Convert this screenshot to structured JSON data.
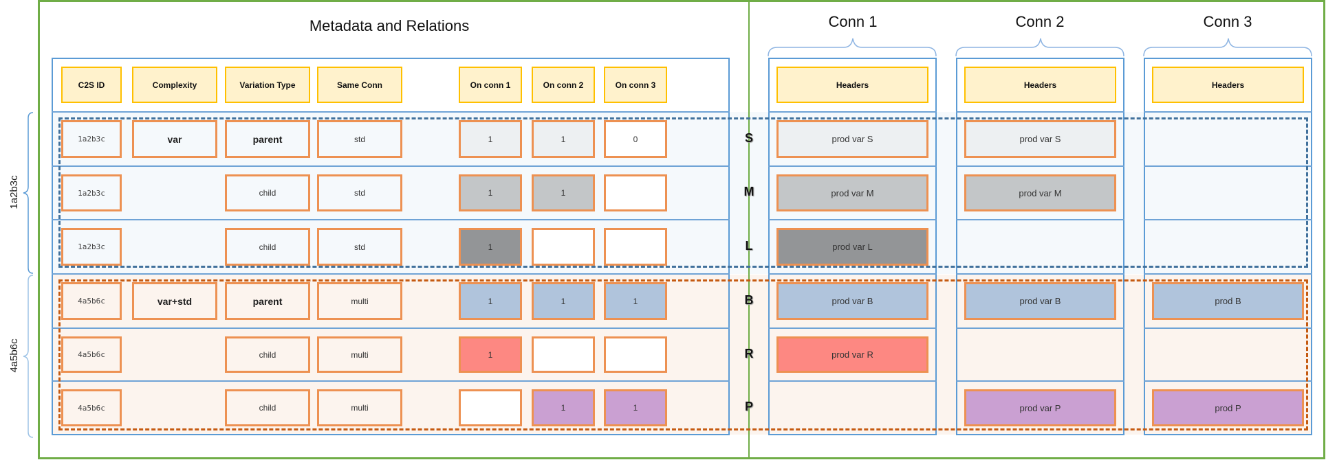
{
  "titles": {
    "metadata": "Metadata and Relations",
    "conn1": "Conn 1",
    "conn2": "Conn 2",
    "conn3": "Conn 3"
  },
  "groups": [
    {
      "label": "1a2b3c"
    },
    {
      "label": "4a5b6c"
    }
  ],
  "headers": {
    "c2sid": "C2S ID",
    "complexity": "Complexity",
    "variation_type": "Variation Type",
    "same_conn": "Same Conn",
    "on_conn1": "On conn 1",
    "on_conn2": "On conn 2",
    "on_conn3": "On conn 3",
    "conn_headers": "Headers"
  },
  "colors": {
    "S": "#edf0f2",
    "M": "#c3c6c8",
    "L": "#939597",
    "B": "#b0c4dc",
    "R": "#fd8882",
    "P": "#caa0d2",
    "empty": "#ffffff"
  },
  "rows": [
    {
      "size": "S",
      "c2sid": "1a2b3c",
      "complexity": "var",
      "variation_type": "parent",
      "same_conn": "std",
      "on_conn1": "1",
      "on_conn2": "1",
      "on_conn3": "0",
      "conn1": "prod var S",
      "conn2": "prod var S",
      "conn3": ""
    },
    {
      "size": "M",
      "c2sid": "1a2b3c",
      "complexity": "",
      "variation_type": "child",
      "same_conn": "std",
      "on_conn1": "1",
      "on_conn2": "1",
      "on_conn3": "",
      "conn1": "prod var M",
      "conn2": "prod var M",
      "conn3": ""
    },
    {
      "size": "L",
      "c2sid": "1a2b3c",
      "complexity": "",
      "variation_type": "child",
      "same_conn": "std",
      "on_conn1": "1",
      "on_conn2": "",
      "on_conn3": "",
      "conn1": "prod var L",
      "conn2": "",
      "conn3": ""
    },
    {
      "size": "B",
      "c2sid": "4a5b6c",
      "complexity": "var+std",
      "variation_type": "parent",
      "same_conn": "multi",
      "on_conn1": "1",
      "on_conn2": "1",
      "on_conn3": "1",
      "conn1": "prod var B",
      "conn2": "prod var B",
      "conn3": "prod B"
    },
    {
      "size": "R",
      "c2sid": "4a5b6c",
      "complexity": "",
      "variation_type": "child",
      "same_conn": "multi",
      "on_conn1": "1",
      "on_conn2": "",
      "on_conn3": "",
      "conn1": "prod var R",
      "conn2": "",
      "conn3": ""
    },
    {
      "size": "P",
      "c2sid": "4a5b6c",
      "complexity": "",
      "variation_type": "child",
      "same_conn": "multi",
      "on_conn1": "",
      "on_conn2": "1",
      "on_conn3": "1",
      "conn1": "",
      "conn2": "prod var P",
      "conn3": "prod P"
    }
  ]
}
